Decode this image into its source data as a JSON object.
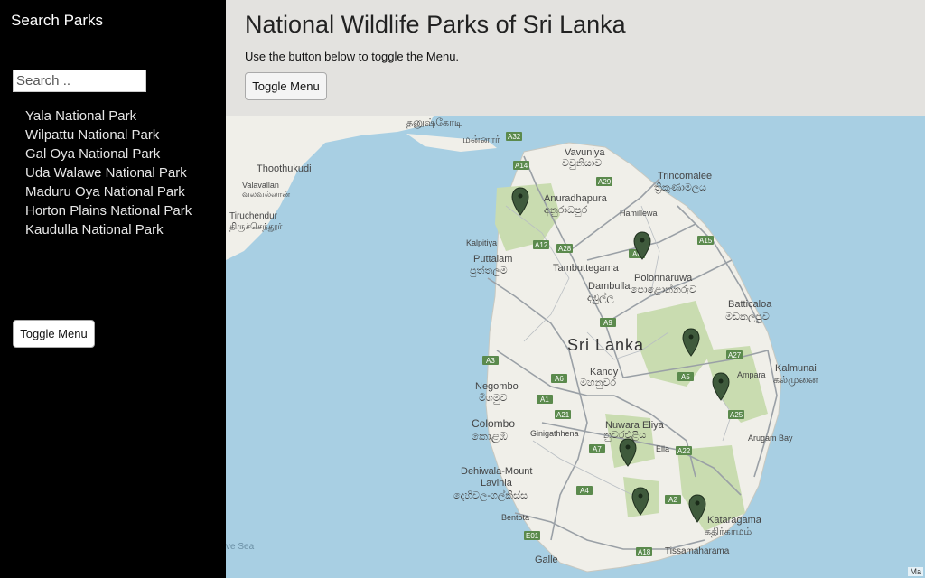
{
  "sidebar": {
    "title": "Search Parks",
    "search_placeholder": "Search ..",
    "parks": [
      "Yala National Park",
      "Wilpattu National Park",
      "Gal Oya National Park",
      "Uda Walawe National Park",
      "Maduru Oya National Park",
      "Horton Plains National Park",
      "Kaudulla National Park"
    ],
    "toggle_label": "Toggle Menu"
  },
  "header": {
    "title": "National Wildlife Parks of Sri Lanka",
    "description": "Use the button below to toggle the Menu.",
    "toggle_label": "Toggle Menu"
  },
  "map": {
    "country_label": "Sri Lanka",
    "place_labels": {
      "thoothukudi": "Thoothukudi",
      "valavallan": "Valavallan",
      "valavallan_tamil": "வலவல்லான்",
      "tiruchendur": "Tiruchendur",
      "tiruchendur_tamil": "திருச்செந்தூர்",
      "vavuniya": "Vavuniya",
      "vavuniya_si": "වවුනියාව",
      "trincomalee": "Trincomalee",
      "trincomalee_si": "ත්‍රිකුණාමලය",
      "anuradhapura": "Anuradhapura",
      "anuradhapura_si": "අනුරාධපුර",
      "hamillewa": "Hamillewa",
      "kalpitiya": "Kalpitiya",
      "puttalam": "Puttalam",
      "puttalam_si": "පුත්තලම",
      "tambuttegama": "Tambuttegama",
      "polonnaruwa": "Polonnaruwa",
      "polonnaruwa_si": "පොළොන්නරුව",
      "dambulla": "Dambulla",
      "dambulla_si": "දඹුල්ල",
      "batticaloa": "Batticaloa",
      "batticaloa_si": "මඩකලපුව",
      "negombo": "Negombo",
      "negombo_si": "මීගමුව",
      "kandy": "Kandy",
      "kandy_si": "මහනුවර",
      "ampara": "Ampara",
      "kalmunai": "Kalmunai",
      "kalmunai_ta": "கல்முனை",
      "colombo": "Colombo",
      "colombo_si": "කොළඹ",
      "nuwara_eliya": "Nuwara Eliya",
      "nuwara_eliya_si": "නුවරඑළිය",
      "ginigathhena": "Ginigathhena",
      "ella": "Ella",
      "arugam_bay": "Arugam Bay",
      "dehiwala": "Dehiwala-Mount",
      "lavinia": "Lavinia",
      "dehiwala_si": "දෙහිවල-ගල්කිස්ස",
      "kataragama": "Kataragama",
      "kataragama_ta": "கதிர்காமம்",
      "bentota": "Bentota",
      "tissamaharama": "Tissamaharama",
      "galle": "Galle",
      "mannar": "மன்னார்",
      "thanushkodi": "தனுஷ்கோடி",
      "sea": "ve Sea"
    },
    "road_shields": [
      "A32",
      "A14",
      "A29",
      "A12",
      "A28",
      "A6",
      "A15",
      "A9",
      "A3",
      "A6",
      "A5",
      "A27",
      "A1",
      "A21",
      "A25",
      "A7",
      "A22",
      "A4",
      "A2",
      "A18",
      "E01"
    ],
    "footer": "Ma"
  }
}
